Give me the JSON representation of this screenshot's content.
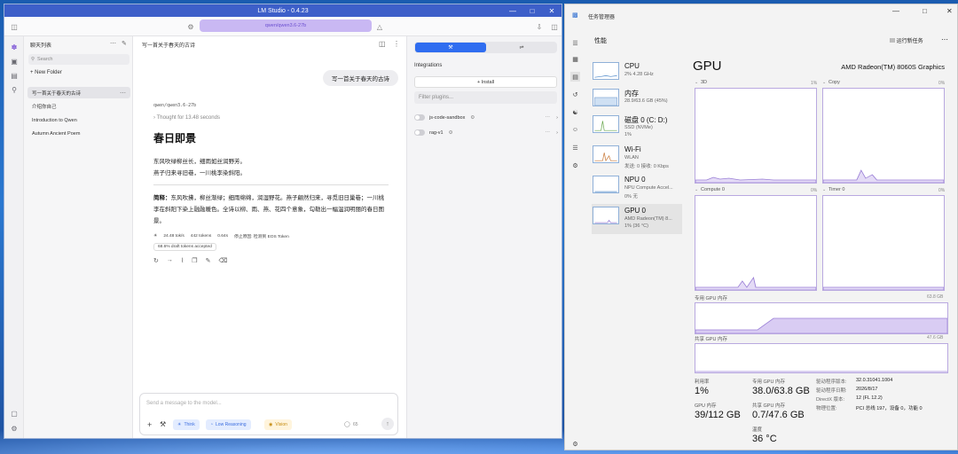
{
  "lmstudio": {
    "window_title": "LM Studio - 0.4.23",
    "model_pill": "qwen/qwen3.6-27b",
    "chats_header": "聊天列表",
    "search_placeholder": "Search",
    "new_folder": "New Folder",
    "chats": [
      "写一首关于春天的古诗",
      "介绍你自己",
      "Introduction to Qwen",
      "Autumn Ancient Poem"
    ],
    "chat_title": "写一首关于春天的古诗",
    "user_message": "写一首关于春天的古诗",
    "model_name": "qwen/qwen3.6-27b",
    "thought": "Thought for 13.48 seconds",
    "poem_title": "春日即景",
    "poem_lines": [
      "东风吹绿柳丝长，细雨如丝润野芳。",
      "燕子归来寻旧巷，一川桃李染斜阳。"
    ],
    "summary_label": "简释：",
    "summary": "东风吹拂，柳丝渐绿；细雨绵绵，润湿野花。燕子翩然归来，寻觅旧日巢巷；一川桃李在斜阳下染上融融暖色。全诗以柳、雨、燕、花四个意象，勾勒出一幅温润明丽的春日图景。",
    "stats": [
      "24.48 tok/s",
      "442 tokens",
      "0.64s",
      "停止原因: 检测到 EOS Token"
    ],
    "draft_tokens": "68.6% draft tokens accepted",
    "composer_placeholder": "Send a message to the model...",
    "chips": [
      "Think",
      "Low Reasoning",
      "Vision"
    ],
    "token_count": "65",
    "integrations_label": "Integrations",
    "install_label": "Install",
    "filter_placeholder": "Filter plugins...",
    "plugins": [
      "js-code-sandbox",
      "rag-v1"
    ]
  },
  "taskmanager": {
    "window_title": "任务管理器",
    "section": "性能",
    "run_new_task": "运行新任务",
    "devices": [
      {
        "name": "CPU",
        "l1": "2% 4.28 GHz",
        "l2": ""
      },
      {
        "name": "内存",
        "l1": "28.9/63.6 GB (45%)",
        "l2": ""
      },
      {
        "name": "磁盘 0 (C: D:)",
        "l1": "SSD (NVMe)",
        "l2": "1%"
      },
      {
        "name": "Wi-Fi",
        "l1": "WLAN",
        "l2": "发送: 0 接收: 0 Kbps"
      },
      {
        "name": "NPU 0",
        "l1": "NPU Compute Accel...",
        "l2": "0% 无"
      },
      {
        "name": "GPU 0",
        "l1": "AMD Radeon(TM) 8...",
        "l2": "1% (36 °C)"
      }
    ],
    "gpu_title": "GPU",
    "gpu_model": "AMD Radeon(TM) 8060S Graphics",
    "engines": [
      {
        "label": "3D",
        "value": "1%"
      },
      {
        "label": "Copy",
        "value": "0%"
      },
      {
        "label": "Compute 0",
        "value": "0%"
      },
      {
        "label": "Timer 0",
        "value": "0%"
      }
    ],
    "dedicated_label": "专用 GPU 内存",
    "dedicated_max": "63.8 GB",
    "shared_label": "共享 GPU 内存",
    "shared_max": "47.6 GB",
    "metrics": [
      {
        "label": "利用率",
        "value": "1%"
      },
      {
        "label": "专用 GPU 内存",
        "value": "38.0/63.8 GB"
      },
      {
        "label": "GPU 内存",
        "value": "39/112 GB"
      },
      {
        "label": "共享 GPU 内存",
        "value": "0.7/47.6 GB"
      },
      {
        "label": "温度",
        "value": "36 °C"
      }
    ],
    "details": [
      {
        "k": "驱动程序版本:",
        "v": "32.0.31041.1004"
      },
      {
        "k": "驱动程序日期:",
        "v": "2026/8/17"
      },
      {
        "k": "DirectX 版本:",
        "v": "12 (FL 12.2)"
      },
      {
        "k": "物理位置:",
        "v": "PCI 总线 197，设备 0，功能 0"
      }
    ],
    "colors": {
      "graph_border": "#b9a9e0",
      "graph_fill": "#d9ccf3",
      "graph_line": "#9a7fd6"
    }
  }
}
